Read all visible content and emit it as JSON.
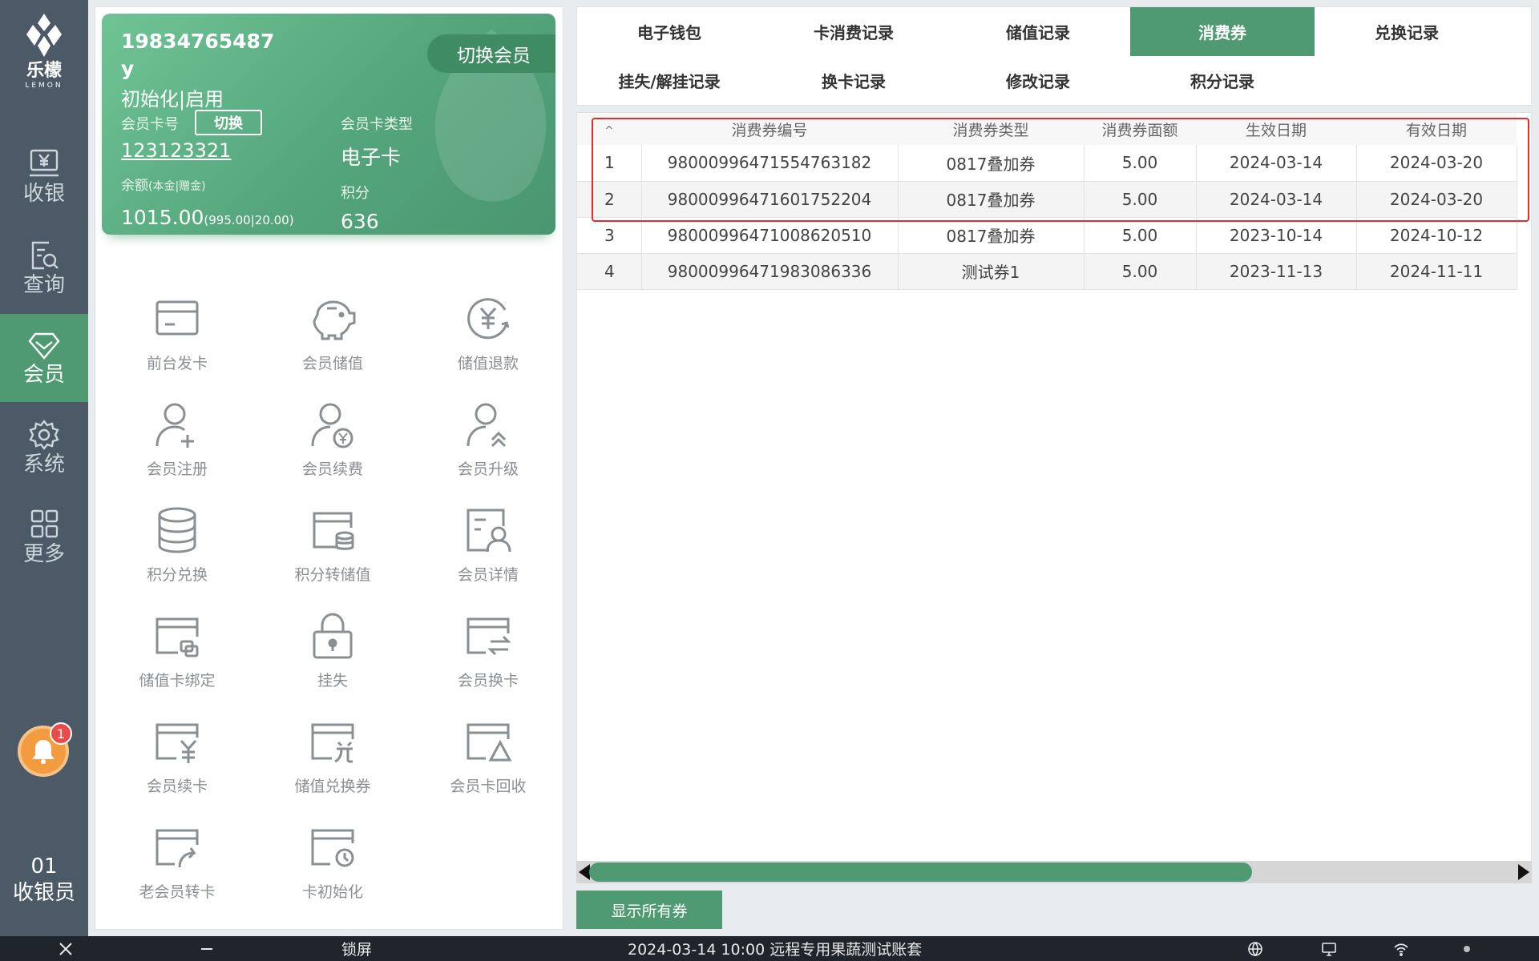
{
  "brand": {
    "name": "乐檬",
    "sub": "LEMON"
  },
  "nav": [
    {
      "label": "收银",
      "icon": "cashier-icon"
    },
    {
      "label": "查询",
      "icon": "query-icon"
    },
    {
      "label": "会员",
      "icon": "member-icon",
      "active": true
    },
    {
      "label": "系统",
      "icon": "gear-icon"
    },
    {
      "label": "更多",
      "icon": "grid-icon"
    }
  ],
  "notification": {
    "count": "1"
  },
  "cashier": {
    "no": "01",
    "role": "收银员"
  },
  "member": {
    "phone": "19834765487",
    "name": "y",
    "status": "初始化|启用",
    "switch_member": "切换会员",
    "card_no_label": "会员卡号",
    "switch_label": "切换",
    "card_no": "123123321",
    "balance_label": "余额",
    "balance_label_sub": "(本金|赠金)",
    "balance": "1015.00",
    "balance_sub": "(995.00|20.00)",
    "card_type_label": "会员卡类型",
    "card_type": "电子卡",
    "points_label": "积分",
    "points": "636"
  },
  "functions": [
    {
      "label": "前台发卡",
      "icon": "card-icon"
    },
    {
      "label": "会员储值",
      "icon": "piggy-bank-icon"
    },
    {
      "label": "储值退款",
      "icon": "refund-icon"
    },
    {
      "label": "会员注册",
      "icon": "user-add-icon"
    },
    {
      "label": "会员续费",
      "icon": "user-renew-icon"
    },
    {
      "label": "会员升级",
      "icon": "user-upgrade-icon"
    },
    {
      "label": "积分兑换",
      "icon": "database-icon"
    },
    {
      "label": "积分转储值",
      "icon": "points-transfer-icon"
    },
    {
      "label": "会员详情",
      "icon": "member-detail-icon"
    },
    {
      "label": "储值卡绑定",
      "icon": "card-bind-icon"
    },
    {
      "label": "挂失",
      "icon": "lock-icon"
    },
    {
      "label": "会员换卡",
      "icon": "card-swap-icon"
    },
    {
      "label": "会员续卡",
      "icon": "card-yen-icon"
    },
    {
      "label": "储值兑换券",
      "icon": "card-exchange-icon"
    },
    {
      "label": "会员卡回收",
      "icon": "card-recycle-icon"
    },
    {
      "label": "老会员转卡",
      "icon": "card-transfer-icon"
    },
    {
      "label": "卡初始化",
      "icon": "card-reset-icon"
    }
  ],
  "tabs": [
    {
      "label": "电子钱包"
    },
    {
      "label": "卡消费记录"
    },
    {
      "label": "储值记录"
    },
    {
      "label": "消费券",
      "active": true
    },
    {
      "label": "兑换记录"
    },
    {
      "label": "挂失/解挂记录"
    },
    {
      "label": "换卡记录"
    },
    {
      "label": "修改记录"
    },
    {
      "label": "积分记录"
    }
  ],
  "table": {
    "columns": [
      "",
      "消费券编号",
      "消费券类型",
      "消费券面额",
      "生效日期",
      "有效日期"
    ],
    "rows": [
      [
        "1",
        "98000996471554763182",
        "0817叠加券",
        "5.00",
        "2024-03-14",
        "2024-03-20"
      ],
      [
        "2",
        "98000996471601752204",
        "0817叠加券",
        "5.00",
        "2024-03-14",
        "2024-03-20"
      ],
      [
        "3",
        "98000996471008620510",
        "0817叠加券",
        "5.00",
        "2023-10-14",
        "2024-10-12"
      ],
      [
        "4",
        "98000996471983086336",
        "测试券1",
        "5.00",
        "2023-11-13",
        "2024-11-11"
      ]
    ]
  },
  "show_all_label": "显示所有券",
  "statusbar": {
    "lock": "锁屏",
    "info": "2024-03-14 10:00 远程专用果蔬测试账套"
  },
  "colors": {
    "accent": "#4f9a72",
    "rail": "#4b5a66",
    "highlight": "#e52d2d",
    "bell": "#f39b3f"
  }
}
